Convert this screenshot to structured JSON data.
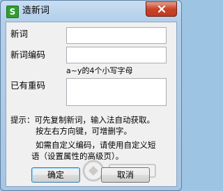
{
  "window": {
    "title": "造新词",
    "app_icon_glyph": "S"
  },
  "form": {
    "new_word_label": "新词",
    "new_word_value": "",
    "encoding_label": "新词编码",
    "encoding_value": "",
    "encoding_hint": "a~y的4个小写字母",
    "existing_label": "已有重码",
    "existing_value": ""
  },
  "tips": {
    "line1": "提示：可先复制新词，输入法自动获取。",
    "line2": "按左右方向键，可增删字。",
    "line3": "如需自定义编码，请使用自定义短",
    "line4": "语（设置属性的高级页）。"
  },
  "buttons": {
    "ok": "确定",
    "cancel": "取消"
  },
  "colors": {
    "close_button": "#c8432b",
    "title_bar": "#b3cfea",
    "app_icon": "#2f9e2f"
  },
  "icons": {
    "app": "sogou-app-icon",
    "close": "close-icon"
  }
}
